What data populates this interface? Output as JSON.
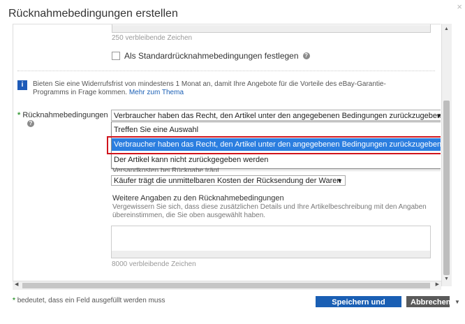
{
  "dialog": {
    "title": "Rücknahmebedingungen erstellen",
    "close_icon": "×"
  },
  "top_field": {
    "counter": "250 verbleibende Zeichen"
  },
  "default_checkbox": {
    "label": "Als Standardrücknahmebedingungen festlegen",
    "checked": false
  },
  "info_box": {
    "text": "Bieten Sie eine Widerrufsfrist von mindestens 1 Monat an, damit Ihre Angebote für die Vorteile des eBay-Garantie-Programms in Frage kommen.",
    "link": "Mehr zum Thema"
  },
  "return_policy": {
    "label": "Rücknahmebedingungen",
    "selected": "Verbraucher haben das Recht, den Artikel unter den angegebenen Bedingungen zurückzugeben.",
    "options": [
      "Treffen Sie eine Auswahl",
      "Verbraucher haben das Recht, den Artikel unter den angegebenen Bedingungen zurückzugeben.",
      "Der Artikel kann nicht zurückgegeben werden"
    ],
    "highlighted_index": 1
  },
  "shipping_cost": {
    "cut_label": "Versandkosten bei Rückgabe trägt",
    "selected": "Käufer trägt die unmittelbaren Kosten der Rücksendung der Waren"
  },
  "more_info": {
    "title": "Weitere Angaben zu den Rücknahmebedingungen",
    "description": "Vergewissern Sie sich, dass diese zusätzlichen Details und Ihre Artikelbeschreibung mit den Angaben übereinstimmen, die Sie oben ausgewählt haben.",
    "counter": "8000 verbleibende Zeichen"
  },
  "footer": {
    "required_note": "bedeutet, dass ein Feld ausgefüllt werden muss",
    "required_star": "*",
    "save_label": "Speichern und schließen",
    "cancel_label": "Abbrechen"
  },
  "colors": {
    "accent": "#1a5fb4",
    "highlight": "#2b7ee0",
    "callout": "#d0141d",
    "required": "#3a9a3a"
  }
}
